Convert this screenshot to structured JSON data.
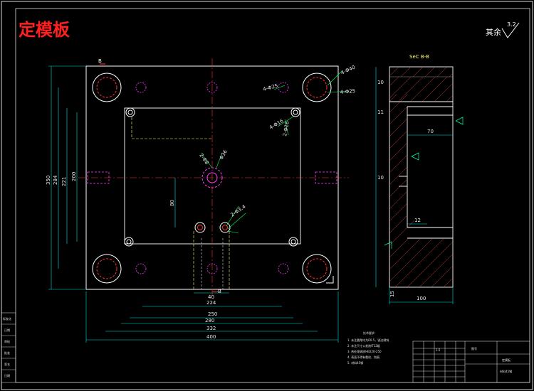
{
  "title": "定模板",
  "roughness": {
    "prefix": "其余",
    "value": "3.2"
  },
  "section_title": "SeC B-B",
  "section_marker": "B",
  "dims_bottom": [
    "40",
    "224",
    "250",
    "280",
    "332",
    "400"
  ],
  "dims_left": [
    "350",
    "284",
    "221",
    "200"
  ],
  "dim_inner": "80",
  "hole_labels": [
    "4-Φ40",
    "4-Φ25",
    "4-Φ25",
    "4-Φ16",
    "2-Φ16",
    "Φ36",
    "2-Φ8",
    "2-Φ3.4"
  ],
  "section_dims": [
    "10",
    "11",
    "70",
    "10",
    "12",
    "15",
    "100"
  ],
  "notes": {
    "heading": "技术要求",
    "lines": [
      "1. 未注圆角均为R0.5，锐边倒钝",
      "2. 未注尺寸公差按IT12级",
      "3. 热处理调质HB220-250",
      "4. 表面不得有裂纹、划痕",
      "5. 材料45钢"
    ]
  },
  "title_block": {
    "scale": "1:2",
    "part_name": "定模板",
    "material": "材料45钢",
    "drawing_no": "图号"
  },
  "side_table": [
    "标准化",
    "日期",
    "审核",
    "批准",
    "签名",
    "日期"
  ]
}
